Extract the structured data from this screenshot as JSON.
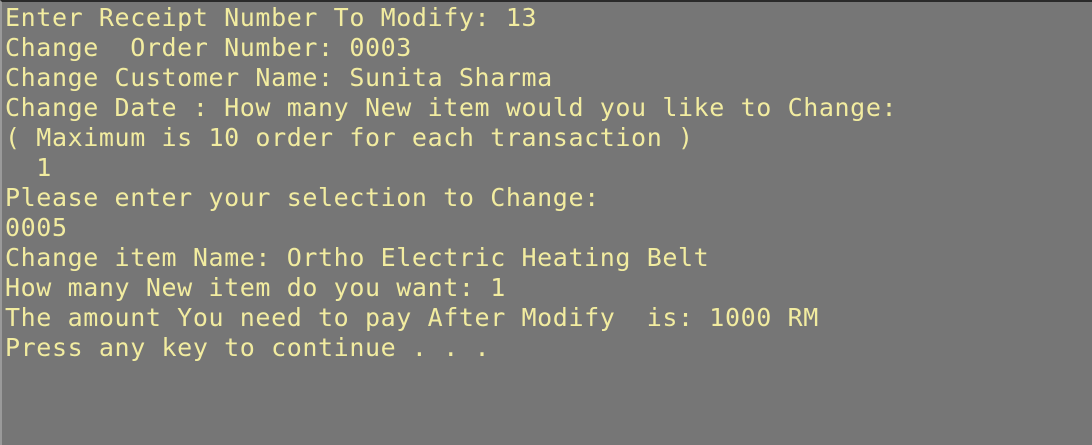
{
  "console": {
    "lines": [
      "Enter Receipt Number To Modify: 13",
      "Change  Order Number: 0003",
      "Change Customer Name: Sunita Sharma",
      "Change Date : How many New item would you like to Change:",
      "( Maximum is 10 order for each transaction )",
      "  1",
      "Please enter your selection to Change:",
      "0005",
      "Change item Name: Ortho Electric Heating Belt",
      "How many New item do you want: 1",
      "The amount You need to pay After Modify  is: 1000 RM",
      "Press any key to continue . . ."
    ],
    "colors": {
      "background": "#767676",
      "text": "#f2eca0"
    }
  }
}
